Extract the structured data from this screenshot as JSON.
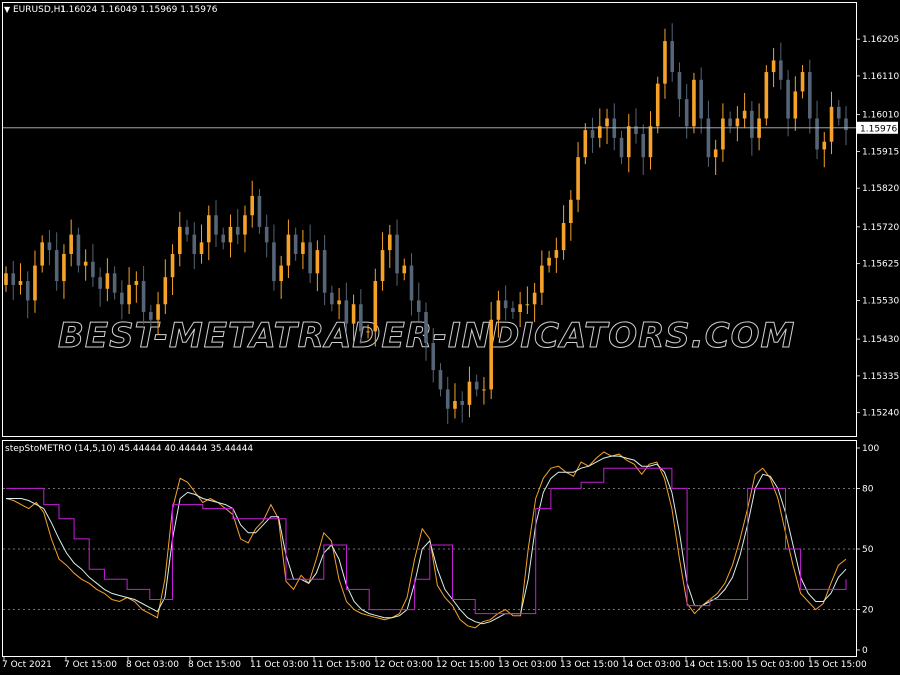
{
  "main_panel": {
    "symbol_caption": "EURUSD,H1",
    "ohlc_caption": "1.16024 1.16049 1.15969 1.15976",
    "price_axis": [
      "1.16205",
      "1.16110",
      "1.16010",
      "1.15915",
      "1.15820",
      "1.15720",
      "1.15625",
      "1.15530",
      "1.15430",
      "1.15335",
      "1.15240"
    ],
    "current_price": "1.15976",
    "current_price_value": 1.15976,
    "price_min": 1.1519,
    "price_max": 1.1627,
    "watermark": "BEST-METATRADER-INDICATORS.COM"
  },
  "indicator_panel": {
    "caption": "stepStoMETRO (14,5,10) 45.44444 40.44444 35.44444",
    "levels": [
      "100",
      "80",
      "50",
      "20",
      "0"
    ],
    "level_values": [
      100,
      80,
      50,
      20,
      0
    ],
    "dotted_levels": [
      80,
      50,
      20
    ]
  },
  "time_axis": [
    "7 Oct 2021",
    "7 Oct 15:00",
    "8 Oct 03:00",
    "8 Oct 15:00",
    "11 Oct 03:00",
    "11 Oct 15:00",
    "12 Oct 03:00",
    "12 Oct 15:00",
    "13 Oct 03:00",
    "13 Oct 15:00",
    "14 Oct 03:00",
    "14 Oct 15:00",
    "15 Oct 03:00",
    "15 Oct 15:00"
  ],
  "colors": {
    "background": "#000000",
    "bull_candle": "#f6a229",
    "bear_candle": "#556476",
    "fast_line": "#f6a229",
    "mid_line": "#d9f0e8",
    "step_line": "#c51fd6",
    "grid": "#ffffff"
  },
  "chart_data": {
    "type": "candlestick",
    "closes": [
      1.156,
      1.1557,
      1.1558,
      1.1553,
      1.1562,
      1.1568,
      1.1566,
      1.1558,
      1.1565,
      1.157,
      1.1562,
      1.1563,
      1.1559,
      1.1556,
      1.156,
      1.1555,
      1.1552,
      1.1557,
      1.1558,
      1.155,
      1.1548,
      1.1552,
      1.1559,
      1.1565,
      1.1572,
      1.157,
      1.1565,
      1.1568,
      1.1575,
      1.157,
      1.1568,
      1.1572,
      1.157,
      1.1575,
      1.158,
      1.1572,
      1.1568,
      1.1558,
      1.1562,
      1.157,
      1.1565,
      1.1568,
      1.156,
      1.1566,
      1.1555,
      1.1552,
      1.1553,
      1.1547,
      1.1552,
      1.1545,
      1.1545,
      1.1558,
      1.1566,
      1.157,
      1.156,
      1.1562,
      1.1553,
      1.155,
      1.1542,
      1.1535,
      1.153,
      1.1525,
      1.1527,
      1.1526,
      1.1532,
      1.153,
      1.153,
      1.1548,
      1.1553,
      1.1551,
      1.155,
      1.1552,
      1.1552,
      1.1555,
      1.1562,
      1.1564,
      1.1566,
      1.1573,
      1.1579,
      1.159,
      1.1597,
      1.1595,
      1.1598,
      1.16,
      1.1595,
      1.159,
      1.1598,
      1.1596,
      1.159,
      1.1598,
      1.1609,
      1.162,
      1.1612,
      1.1605,
      1.1598,
      1.161,
      1.16,
      1.159,
      1.1592,
      1.16,
      1.1598,
      1.16,
      1.1602,
      1.1595,
      1.16,
      1.1612,
      1.1615,
      1.161,
      1.16,
      1.1607,
      1.1612,
      1.16,
      1.1592,
      1.1594,
      1.1603,
      1.16,
      1.1597
    ],
    "series": [
      {
        "values": [
          75,
          74,
          72,
          70,
          73,
          68,
          55,
          45,
          42,
          38,
          35,
          33,
          30,
          28,
          25,
          24,
          26,
          24,
          20,
          18,
          16,
          35,
          70,
          85,
          83,
          78,
          73,
          75,
          73,
          70,
          67,
          55,
          53,
          60,
          64,
          72,
          65,
          34,
          30,
          37,
          33,
          45,
          58,
          54,
          35,
          24,
          20,
          18,
          17,
          16,
          15,
          16,
          18,
          26,
          45,
          60,
          55,
          32,
          26,
          22,
          15,
          12,
          11,
          14,
          15,
          18,
          20,
          17,
          17,
          50,
          75,
          85,
          90,
          91,
          88,
          86,
          93,
          91,
          95,
          98,
          96,
          97,
          94,
          92,
          87,
          92,
          93,
          85,
          70,
          45,
          23,
          18,
          22,
          25,
          28,
          33,
          42,
          55,
          70,
          87,
          90,
          85,
          75,
          58,
          42,
          28,
          24,
          20,
          23,
          33,
          42,
          45
        ]
      },
      {
        "values": [
          75,
          75,
          75,
          74,
          72,
          70,
          63,
          55,
          48,
          43,
          40,
          36,
          33,
          30,
          28,
          27,
          26,
          25,
          23,
          21,
          19,
          26,
          55,
          75,
          78,
          77,
          75,
          74,
          73,
          72,
          70,
          62,
          58,
          58,
          62,
          66,
          66,
          47,
          35,
          35,
          33,
          38,
          48,
          52,
          45,
          32,
          24,
          20,
          18,
          17,
          16,
          16,
          17,
          20,
          33,
          50,
          54,
          40,
          30,
          25,
          20,
          16,
          14,
          13,
          14,
          16,
          18,
          18,
          18,
          35,
          62,
          78,
          85,
          88,
          88,
          88,
          90,
          91,
          93,
          95,
          96,
          96,
          95,
          94,
          91,
          91,
          92,
          88,
          78,
          58,
          33,
          22,
          22,
          24,
          26,
          30,
          36,
          47,
          62,
          80,
          87,
          86,
          80,
          68,
          52,
          36,
          28,
          24,
          24,
          28,
          36,
          40
        ]
      },
      {
        "values": [
          80,
          80,
          80,
          80,
          80,
          72,
          72,
          65,
          65,
          55,
          55,
          40,
          40,
          35,
          35,
          35,
          30,
          30,
          30,
          25,
          25,
          25,
          72,
          72,
          72,
          72,
          70,
          70,
          70,
          70,
          65,
          65,
          65,
          65,
          65,
          65,
          65,
          35,
          35,
          35,
          35,
          35,
          52,
          52,
          52,
          30,
          30,
          30,
          20,
          20,
          20,
          20,
          20,
          20,
          35,
          35,
          52,
          52,
          52,
          25,
          25,
          25,
          18,
          18,
          18,
          18,
          18,
          18,
          18,
          18,
          70,
          70,
          80,
          80,
          80,
          80,
          83,
          83,
          83,
          90,
          90,
          90,
          90,
          90,
          90,
          90,
          90,
          90,
          80,
          80,
          22,
          22,
          22,
          25,
          25,
          25,
          25,
          25,
          80,
          80,
          80,
          80,
          80,
          50,
          50,
          30,
          30,
          30,
          30,
          30,
          30,
          35
        ]
      }
    ]
  }
}
